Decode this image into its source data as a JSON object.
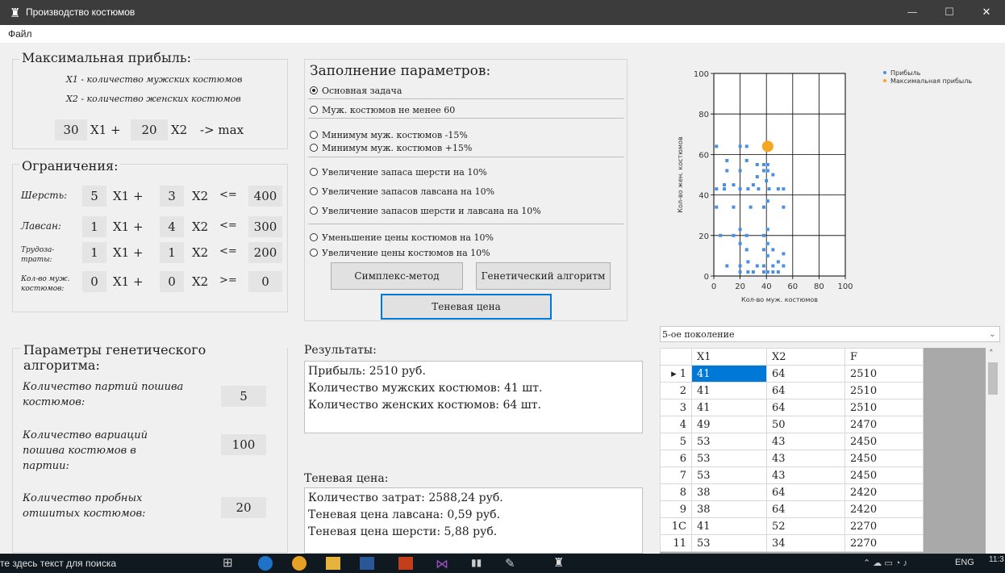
{
  "window": {
    "title": "Производство костюмов"
  },
  "menu": {
    "file": "Файл"
  },
  "maxprofit": {
    "title": "Максимальная прибыль:",
    "x1_desc": "X1 - количество мужских костюмов",
    "x2_desc": "X2 - количество женских костюмов",
    "c1": "30",
    "x1": "X1 +",
    "c2": "20",
    "x2": "X2",
    "goal": "-> max"
  },
  "constraints": {
    "title": "Ограничения:",
    "rows": [
      {
        "label": "Шерсть:",
        "a": "5",
        "b": "3",
        "op": "<=",
        "rhs": "400"
      },
      {
        "label": "Лавсан:",
        "a": "1",
        "b": "4",
        "op": "<=",
        "rhs": "300"
      },
      {
        "label": "Трудоза-\nтраты:",
        "a": "1",
        "b": "1",
        "op": "<=",
        "rhs": "200"
      },
      {
        "label": "Кол-во муж.\nкостюмов:",
        "a": "0",
        "b": "0",
        "op": ">=",
        "rhs": "0"
      }
    ],
    "x1": "X1 +",
    "x2": "X2"
  },
  "params": {
    "title": "Заполнение параметров:",
    "options": [
      {
        "label": "Основная задача",
        "checked": true
      },
      {
        "label": "Муж. костюмов не менее 60",
        "checked": false
      },
      {
        "label": "Минимум муж. костюмов -15%",
        "checked": false
      },
      {
        "label": "Минимум муж. костюмов +15%",
        "checked": false
      },
      {
        "label": "Увеличение запаса шерсти на 10%",
        "checked": false
      },
      {
        "label": "Увеличение запасов лавсана на 10%",
        "checked": false
      },
      {
        "label": "Увеличение запасов шерсти и лавсана на 10%",
        "checked": false
      },
      {
        "label": "Уменьшение цены костюмов на 10%",
        "checked": false
      },
      {
        "label": "Увеличение цены костюмов на 10%",
        "checked": false
      }
    ],
    "simplex_btn": "Симплекс-метод",
    "genetic_btn": "Генетический алгоритм",
    "shadow_btn": "Теневая цена"
  },
  "ga": {
    "title": "Параметры генетического алгоритма:",
    "p1_label": "Количество партий пошива костюмов:",
    "p1_value": "5",
    "p2_label": "Количество вариаций пошива костюмов в партии:",
    "p2_value": "100",
    "p3_label": "Количество пробных отшитых костюмов:",
    "p3_value": "20"
  },
  "results": {
    "title": "Результаты:",
    "lines": [
      "Прибыль: 2510 руб.",
      "Количество мужских костюмов: 41 шт.",
      "Количество женских костюмов: 64 шт."
    ]
  },
  "shadow": {
    "title": "Теневая цена:",
    "lines": [
      "Количество затрат: 2588,24 руб.",
      "Теневая цена лавсана: 0,59 руб.",
      "Теневая цена шерсти: 5,88 руб."
    ]
  },
  "chart_data": {
    "type": "scatter",
    "xlabel": "Кол-во муж. костюмов",
    "ylabel": "Кол-во жен. костюмов",
    "xlim": [
      0,
      100
    ],
    "ylim": [
      0,
      100
    ],
    "xticks": [
      "0",
      "20",
      "40",
      "60",
      "80",
      "100"
    ],
    "yticks": [
      "0",
      "20",
      "40",
      "60",
      "80",
      "100"
    ],
    "legend": [
      "Прибыль",
      "Максимальная прибыль"
    ],
    "legend_position": "top-right",
    "grid": true,
    "colors": {
      "profit": "#4a90e2",
      "max": "#f5a623"
    },
    "series": [
      {
        "name": "Прибыль",
        "points": [
          [
            2,
            64
          ],
          [
            20,
            64
          ],
          [
            25,
            64
          ],
          [
            33,
            55
          ],
          [
            38,
            55
          ],
          [
            41,
            55
          ],
          [
            10,
            57
          ],
          [
            25,
            57
          ],
          [
            41,
            52
          ],
          [
            45,
            50
          ],
          [
            10,
            52
          ],
          [
            20,
            52
          ],
          [
            33,
            49
          ],
          [
            38,
            52
          ],
          [
            8,
            45
          ],
          [
            15,
            45
          ],
          [
            30,
            45
          ],
          [
            40,
            47
          ],
          [
            42,
            43
          ],
          [
            53,
            43
          ],
          [
            2,
            43
          ],
          [
            8,
            43
          ],
          [
            20,
            43
          ],
          [
            26,
            43
          ],
          [
            34,
            43
          ],
          [
            49,
            43
          ],
          [
            2,
            34
          ],
          [
            15,
            34
          ],
          [
            28,
            34
          ],
          [
            38,
            34
          ],
          [
            41,
            37
          ],
          [
            53,
            34
          ],
          [
            5,
            20
          ],
          [
            15,
            20
          ],
          [
            20,
            23
          ],
          [
            25,
            20
          ],
          [
            38,
            20
          ],
          [
            41,
            23
          ],
          [
            20,
            16
          ],
          [
            25,
            13
          ],
          [
            38,
            13
          ],
          [
            41,
            16
          ],
          [
            45,
            13
          ],
          [
            53,
            11
          ],
          [
            10,
            5
          ],
          [
            20,
            5
          ],
          [
            26,
            7
          ],
          [
            30,
            2
          ],
          [
            33,
            5
          ],
          [
            38,
            5
          ],
          [
            41,
            10
          ],
          [
            45,
            5
          ],
          [
            49,
            7
          ],
          [
            53,
            5
          ],
          [
            20,
            2
          ],
          [
            26,
            2
          ],
          [
            38,
            2
          ],
          [
            41,
            2
          ],
          [
            45,
            2
          ],
          [
            49,
            2
          ]
        ]
      },
      {
        "name": "Максимальная прибыль",
        "points": [
          [
            41,
            64
          ]
        ]
      }
    ]
  },
  "generation": {
    "selected": "5-ое поколение"
  },
  "table": {
    "headers": [
      "",
      "X1",
      "X2",
      "F"
    ],
    "rows": [
      [
        "1",
        "41",
        "64",
        "2510"
      ],
      [
        "2",
        "41",
        "64",
        "2510"
      ],
      [
        "3",
        "41",
        "64",
        "2510"
      ],
      [
        "4",
        "49",
        "50",
        "2470"
      ],
      [
        "5",
        "53",
        "43",
        "2450"
      ],
      [
        "6",
        "53",
        "43",
        "2450"
      ],
      [
        "7",
        "53",
        "43",
        "2450"
      ],
      [
        "8",
        "38",
        "64",
        "2420"
      ],
      [
        "9",
        "38",
        "64",
        "2420"
      ],
      [
        "1C",
        "41",
        "52",
        "2270"
      ],
      [
        "11",
        "53",
        "34",
        "2270"
      ]
    ]
  },
  "taskbar": {
    "search": "те здесь текст для поиска",
    "lang": "ENG",
    "time": "11:3"
  }
}
